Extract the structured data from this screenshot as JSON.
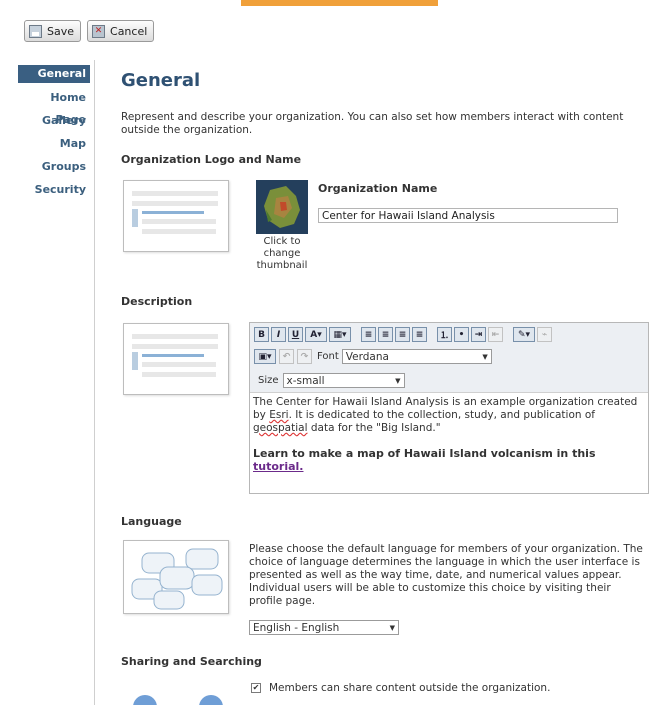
{
  "toolbar": {
    "save_label": "Save",
    "cancel_label": "Cancel"
  },
  "sidebar": {
    "items": [
      {
        "label": "General"
      },
      {
        "label": "Home Page"
      },
      {
        "label": "Gallery"
      },
      {
        "label": "Map"
      },
      {
        "label": "Groups"
      },
      {
        "label": "Security"
      }
    ]
  },
  "main": {
    "title": "General",
    "intro": "Represent and describe your organization. You can also set how members interact with content outside the organization.",
    "logo_section": {
      "heading": "Organization Logo and Name",
      "thumbnail_caption": "Click to change thumbnail",
      "name_label": "Organization Name",
      "name_value": "Center for Hawaii Island Analysis"
    },
    "description_section": {
      "heading": "Description",
      "font_label": "Font",
      "font_value": "Verdana",
      "size_label": "Size",
      "size_value": "x-small",
      "text_part1": "The Center for Hawaii Island Analysis is an example organization created by ",
      "text_esri": "Esri",
      "text_part2": ". It is dedicated to the collection, study, and publication of ",
      "text_geo": "geospatial",
      "text_part3": " data for the \"Big Island.\"",
      "bold_text": "Learn to make a map of Hawaii Island volcanism in this ",
      "link_text": "tutorial."
    },
    "language_section": {
      "heading": "Language",
      "text": "Please choose the default language for members of your organization. The choice of language determines the language in which the user interface is presented as well as the way time, date, and numerical values appear. Individual users will be able to customize this choice by visiting their profile page.",
      "selected": "English - English"
    },
    "sharing_section": {
      "heading": "Sharing and Searching",
      "share_checkbox_label": "Members can share content outside the organization.",
      "share_checked": true
    }
  },
  "colors": {
    "accent": "#f0a03a",
    "nav_active": "#3a5f82",
    "title": "#2f5173",
    "link": "#6b2a8a"
  }
}
